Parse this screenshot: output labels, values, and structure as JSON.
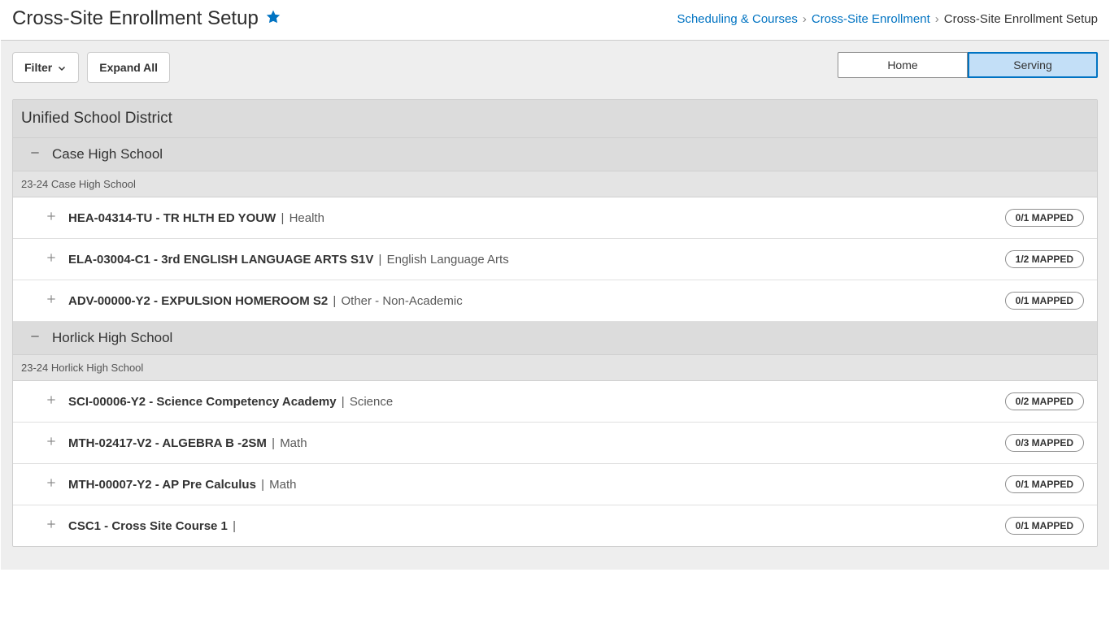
{
  "header": {
    "title": "Cross-Site Enrollment Setup",
    "breadcrumb": {
      "b1": "Scheduling & Courses",
      "b2": "Cross-Site Enrollment",
      "current": "Cross-Site Enrollment Setup"
    }
  },
  "toolbar": {
    "filter_label": "Filter",
    "expand_label": "Expand All",
    "segment_left": "Home",
    "segment_right": "Serving"
  },
  "district": {
    "name": "Unified School District"
  },
  "schools": [
    {
      "name": "Case High School",
      "sub": "23-24 Case High School",
      "courses": [
        {
          "code_title": "HEA-04314-TU - TR HLTH ED YOUW",
          "dept": "Health",
          "badge": "0/1 MAPPED"
        },
        {
          "code_title": "ELA-03004-C1 - 3rd ENGLISH LANGUAGE ARTS S1V",
          "dept": "English Language Arts",
          "badge": "1/2 MAPPED"
        },
        {
          "code_title": "ADV-00000-Y2 - EXPULSION HOMEROOM S2",
          "dept": "Other - Non-Academic",
          "badge": "0/1 MAPPED"
        }
      ]
    },
    {
      "name": "Horlick High School",
      "sub": "23-24 Horlick High School",
      "courses": [
        {
          "code_title": "SCI-00006-Y2 - Science Competency Academy",
          "dept": "Science",
          "badge": "0/2 MAPPED"
        },
        {
          "code_title": "MTH-02417-V2 - ALGEBRA B -2SM",
          "dept": "Math",
          "badge": "0/3 MAPPED"
        },
        {
          "code_title": "MTH-00007-Y2 - AP Pre Calculus",
          "dept": "Math",
          "badge": "0/1 MAPPED"
        },
        {
          "code_title": "CSC1 - Cross Site Course 1",
          "dept": "",
          "badge": "0/1 MAPPED"
        }
      ]
    }
  ]
}
